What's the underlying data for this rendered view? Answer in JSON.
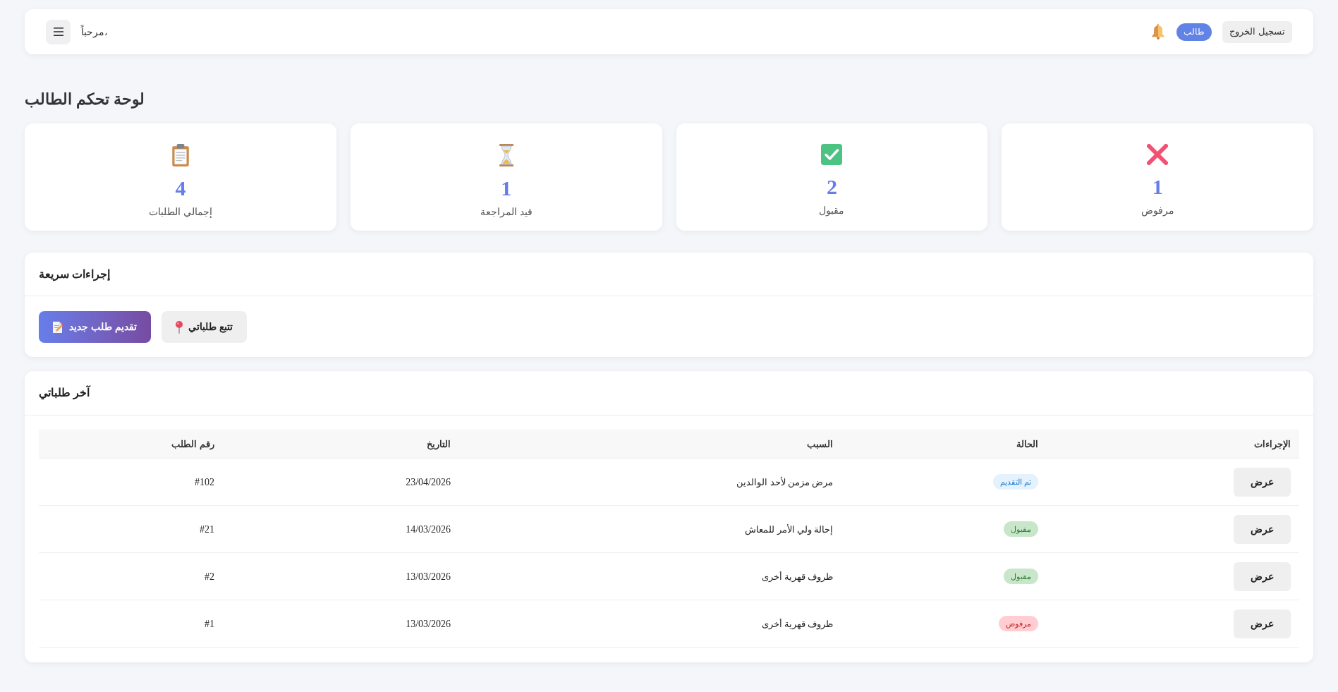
{
  "header": {
    "greeting": "مرحباً،",
    "role_badge": "طالب",
    "logout_button": "تسجيل الخروج"
  },
  "page_title": "لوحة تحكم الطالب",
  "stats": [
    {
      "kind": "rejected",
      "value": "1",
      "label": "مرفوض"
    },
    {
      "kind": "accepted",
      "value": "2",
      "label": "مقبول"
    },
    {
      "kind": "pending",
      "value": "1",
      "label": "قيد المراجعة"
    },
    {
      "kind": "total",
      "value": "4",
      "label": "إجمالي الطلبات"
    }
  ],
  "quick_actions": {
    "title": "إجراءات سريعة",
    "buttons": [
      {
        "kind": "secondary",
        "label": "تتبع طلباتي"
      },
      {
        "kind": "primary",
        "label": "تقديم طلب جديد"
      }
    ]
  },
  "recent_requests": {
    "title": "آخر طلباتي",
    "columns": [
      "الإجراءات",
      "الحالة",
      "السبب",
      "التاريخ",
      "رقم الطلب"
    ],
    "rows": [
      {
        "number": "#102",
        "date": "23/04/2026",
        "reason": "مرض مزمن لأحد الوالدين",
        "status": "تم التقديم",
        "kind": "submitted",
        "action": "عرض"
      },
      {
        "number": "#21",
        "date": "14/03/2026",
        "reason": "إحالة ولي الأمر للمعاش",
        "status": "مقبول",
        "kind": "accepted",
        "action": "عرض"
      },
      {
        "number": "#2",
        "date": "13/03/2026",
        "reason": "ظروف قهرية أخرى",
        "status": "مقبول",
        "kind": "accepted",
        "action": "عرض"
      },
      {
        "number": "#1",
        "date": "13/03/2026",
        "reason": "ظروف قهرية أخرى",
        "status": "مرفوض",
        "kind": "rejected",
        "action": "عرض"
      }
    ]
  }
}
